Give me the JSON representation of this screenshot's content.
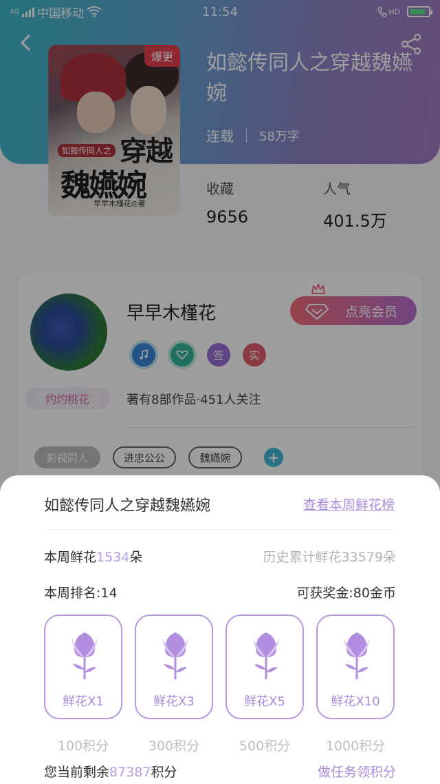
{
  "status_bar": {
    "network": "4G",
    "carrier": "中国移动",
    "time": "11:54",
    "hd_label": "HD"
  },
  "book": {
    "badge": "爆更",
    "cover_small_title": "如懿传同人之",
    "cover_big_title_1": "穿越",
    "cover_big_title_2": "魏嬿婉",
    "cover_author": "早早木槿花◎著",
    "title": "如懿传同人之穿越魏嬿婉",
    "status": "连载",
    "word_count": "58万字",
    "stats": {
      "collect_label": "收藏",
      "collect_value": "9656",
      "popular_label": "人气",
      "popular_value": "401.5万"
    }
  },
  "author": {
    "name": "早早木槿花",
    "avatar_tag": "灼灼桃花",
    "vip_button": "点亮会员",
    "medals": [
      "签",
      "实"
    ],
    "works_info": "著有8部作品·451人关注",
    "tags": [
      "影视同人",
      "进忠公公",
      "魏嬿婉"
    ],
    "tag_add": "+"
  },
  "sheet": {
    "title": "如懿传同人之穿越魏嬿婉",
    "rank_link": "查看本周鲜花榜",
    "week_flowers_prefix": "本周鲜花",
    "week_flowers_value": "1534",
    "week_flowers_suffix": "朵",
    "history_flowers": "历史累计鲜花33579朵",
    "week_rank": "本周排名:14",
    "reward": "可获奖金:80金币",
    "flower_options": [
      {
        "label": "鲜花X1",
        "price": "100积分"
      },
      {
        "label": "鲜花X3",
        "price": "300积分"
      },
      {
        "label": "鲜花X5",
        "price": "500积分"
      },
      {
        "label": "鲜花X10",
        "price": "1000积分"
      }
    ],
    "balance_prefix": "您当前剩余",
    "balance_value": "87387",
    "balance_suffix": "积分",
    "task_link": "做任务领积分"
  },
  "colors": {
    "accent": "#a989d9",
    "flower": "#b797e0",
    "hero_gradient_start": "#3db9c9",
    "hero_gradient_end": "#a37bc2"
  }
}
